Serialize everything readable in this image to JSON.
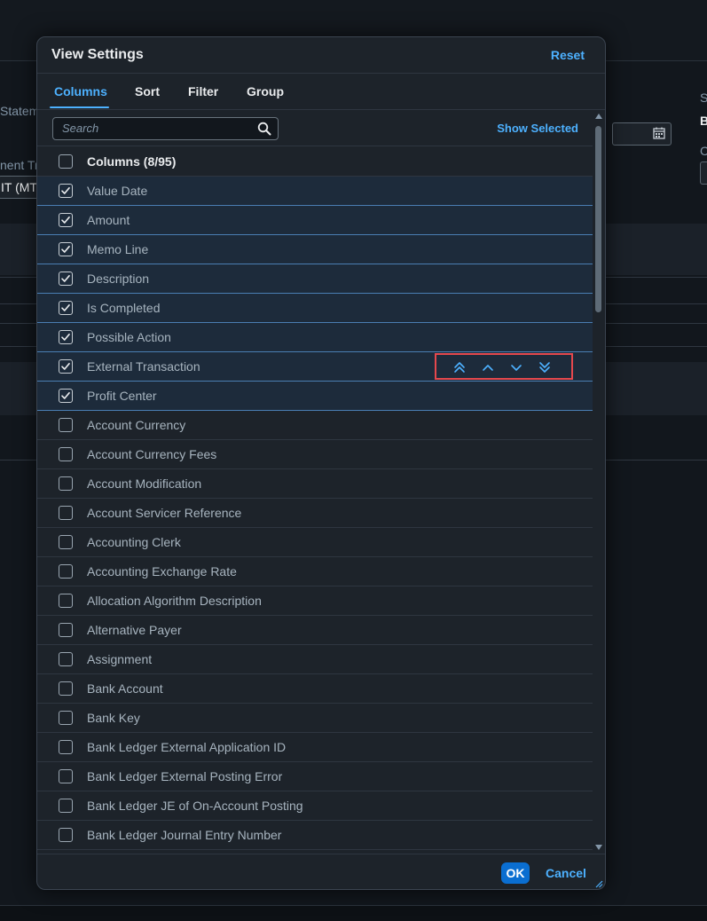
{
  "background": {
    "label_statement": "Statem",
    "label_payment": "nent Tra",
    "value_payment": "IT (MTS",
    "label_right_s": "S",
    "value_right_b": "B",
    "label_right_c": "C"
  },
  "dialog": {
    "title": "View Settings",
    "reset_label": "Reset"
  },
  "tabs": [
    {
      "label": "Columns",
      "active": true
    },
    {
      "label": "Sort",
      "active": false
    },
    {
      "label": "Filter",
      "active": false
    },
    {
      "label": "Group",
      "active": false
    }
  ],
  "toolbar": {
    "search_placeholder": "Search",
    "show_selected_label": "Show Selected"
  },
  "list": {
    "header_label": "Columns (8/95)",
    "header_checked": false,
    "items": [
      {
        "label": "Value Date",
        "checked": true
      },
      {
        "label": "Amount",
        "checked": true
      },
      {
        "label": "Memo Line",
        "checked": true
      },
      {
        "label": "Description",
        "checked": true
      },
      {
        "label": "Is Completed",
        "checked": true
      },
      {
        "label": "Possible Action",
        "checked": true
      },
      {
        "label": "External Transaction",
        "checked": true
      },
      {
        "label": "Profit Center",
        "checked": true
      },
      {
        "label": "Account Currency",
        "checked": false
      },
      {
        "label": "Account Currency Fees",
        "checked": false
      },
      {
        "label": "Account Modification",
        "checked": false
      },
      {
        "label": "Account Servicer Reference",
        "checked": false
      },
      {
        "label": "Accounting Clerk",
        "checked": false
      },
      {
        "label": "Accounting Exchange Rate",
        "checked": false
      },
      {
        "label": "Allocation Algorithm Description",
        "checked": false
      },
      {
        "label": "Alternative Payer",
        "checked": false
      },
      {
        "label": "Assignment",
        "checked": false
      },
      {
        "label": "Bank Account",
        "checked": false
      },
      {
        "label": "Bank Key",
        "checked": false
      },
      {
        "label": "Bank Ledger External Application ID",
        "checked": false
      },
      {
        "label": "Bank Ledger External Posting Error",
        "checked": false
      },
      {
        "label": "Bank Ledger JE of On-Account Posting",
        "checked": false
      },
      {
        "label": "Bank Ledger Journal Entry Number",
        "checked": false
      }
    ],
    "focused_index": 6,
    "move_buttons": [
      "move-to-top-icon",
      "move-up-icon",
      "move-down-icon",
      "move-to-bottom-icon"
    ]
  },
  "footer": {
    "ok_label": "OK",
    "cancel_label": "Cancel"
  },
  "colors": {
    "accent": "#4db1ff",
    "primary_button": "#0a6ed1",
    "highlight_border": "#e5484d"
  }
}
